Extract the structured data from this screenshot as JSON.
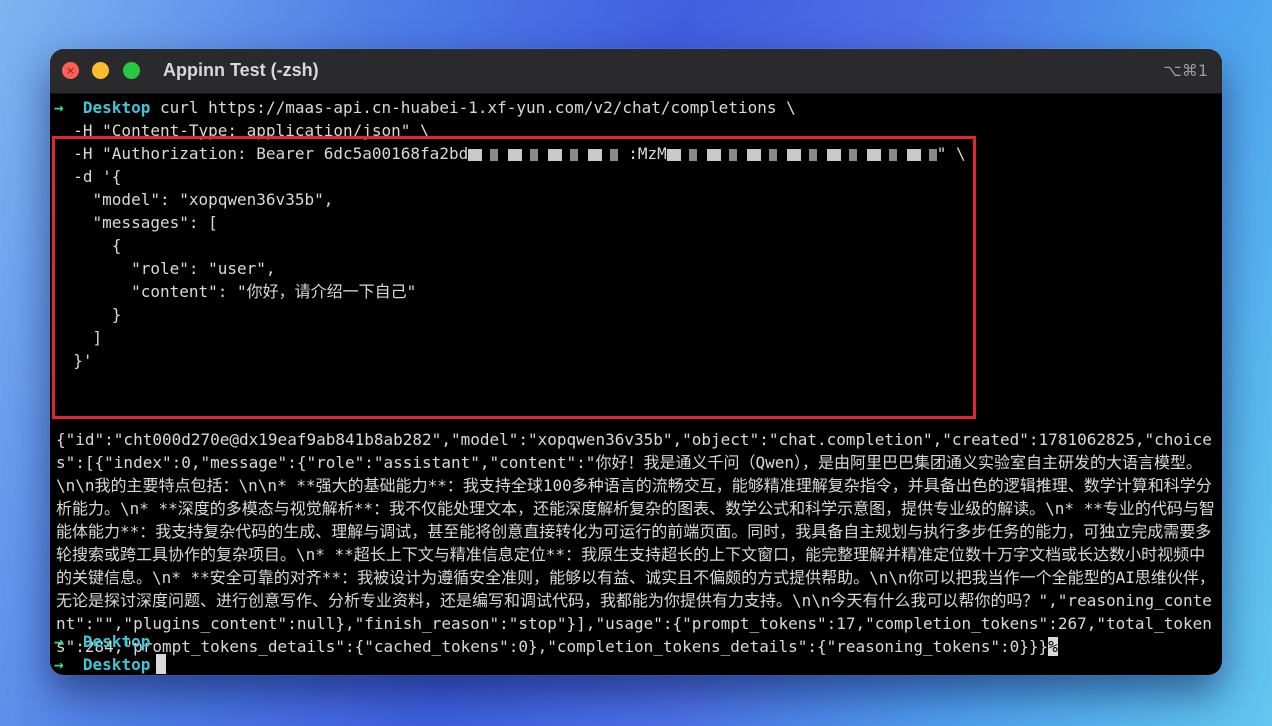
{
  "window": {
    "title": "Appinn Test (-zsh)",
    "shortcut": "⌥⌘1"
  },
  "colors": {
    "prompt_arrow": "#39d98a",
    "prompt_dir": "#3ec6d8",
    "highlight_box": "#e0262e"
  },
  "prompt": {
    "arrow": "→",
    "dir": "Desktop"
  },
  "command": {
    "line1": " curl https://maas-api.cn-huabei-1.xf-yun.com/v2/chat/completions \\",
    "line2": "-H \"Content-Type: application/json\" \\",
    "line3_prefix": "-H \"Authorization: Bearer 6dc5a00168fa2bd",
    "line3_mid": ":MzM",
    "line3_suffix": "\" \\",
    "line4": "-d '{",
    "line5": "  \"model\": \"xopqwen36v35b\",",
    "line6": "  \"messages\": [",
    "line7": "    {",
    "line8": "      \"role\": \"user\",",
    "line9": "      \"content\": \"你好，请介绍一下自己\"",
    "line10": "    }",
    "line11": "  ]",
    "line12": "}'"
  },
  "response": "{\"id\":\"cht000d270e@dx19eaf9ab841b8ab282\",\"model\":\"xopqwen36v35b\",\"object\":\"chat.completion\",\"created\":1781062825,\"choices\":[{\"index\":0,\"message\":{\"role\":\"assistant\",\"content\":\"你好！我是通义千问（Qwen），是由阿里巴巴集团通义实验室自主研发的大语言模型。\\n\\n我的主要特点包括：\\n\\n* **强大的基础能力**：我支持全球100多种语言的流畅交互，能够精准理解复杂指令，并具备出色的逻辑推理、数学计算和科学分析能力。\\n* **深度的多模态与视觉解析**：我不仅能处理文本，还能深度解析复杂的图表、数学公式和科学示意图，提供专业级的解读。\\n* **专业的代码与智能体能力**：我支持复杂代码的生成、理解与调试，甚至能将创意直接转化为可运行的前端页面。同时，我具备自主规划与执行多步任务的能力，可独立完成需要多轮搜索或跨工具协作的复杂项目。\\n* **超长上下文与精准信息定位**：我原生支持超长的上下文窗口，能完整理解并精准定位数十万字文档或长达数小时视频中的关键信息。\\n* **安全可靠的对齐**：我被设计为遵循安全准则，能够以有益、诚实且不偏颇的方式提供帮助。\\n\\n你可以把我当作一个全能型的AI思维伙伴，无论是探讨深度问题、进行创意写作、分析专业资料，还是编写和调试代码，我都能为你提供有力支持。\\n\\n今天有什么我可以帮你的吗？\",\"reasoning_content\":\"\",\"plugins_content\":null},\"finish_reason\":\"stop\"}],\"usage\":{\"prompt_tokens\":17,\"completion_tokens\":267,\"total_tokens\":284,\"prompt_tokens_details\":{\"cached_tokens\":0},\"completion_tokens_details\":{\"reasoning_tokens\":0}}}",
  "end_marker": "%"
}
